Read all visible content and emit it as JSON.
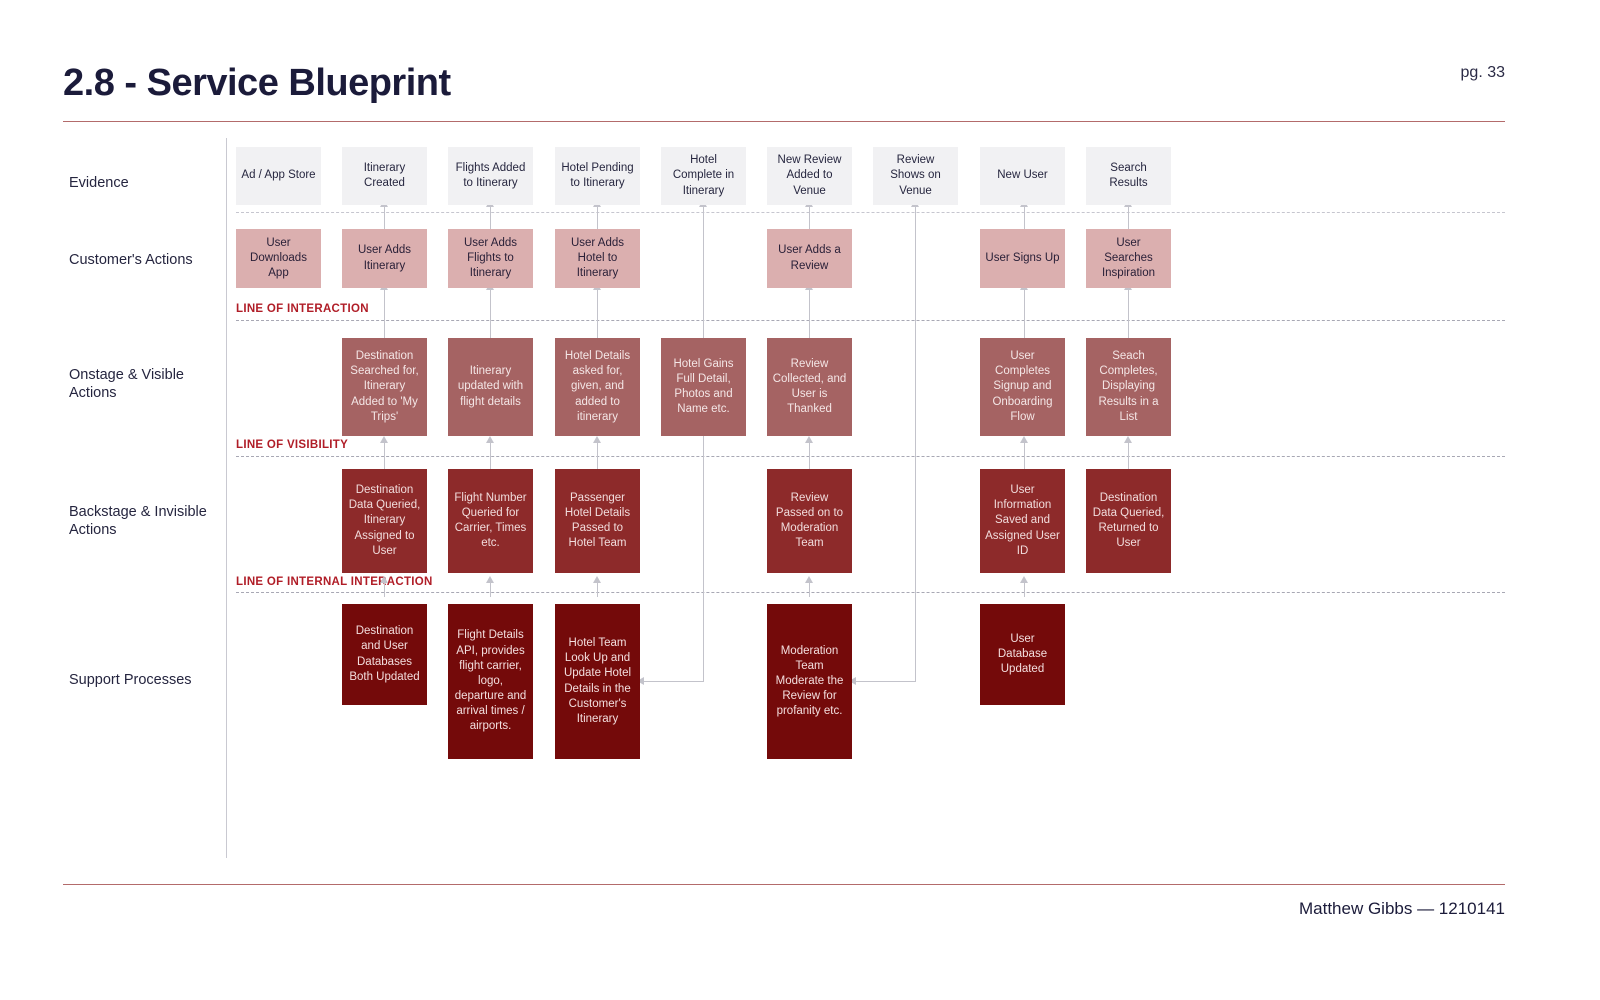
{
  "header": {
    "title": "2.8 - Service Blueprint",
    "page_number": "pg. 33"
  },
  "footer": {
    "credit": "Matthew Gibbs — 1210141"
  },
  "colors": {
    "accent_rule": "#b36b6b",
    "line_label": "#b01d27",
    "evidence": "#f1f1f3",
    "customer_actions": "#dbafaf",
    "onstage": "#a56363",
    "backstage": "#8d2a2a",
    "support": "#740a0a",
    "connector": "#c3c3cb",
    "title": "#1b1b3a"
  },
  "rows": [
    {
      "key": "evidence",
      "label": "Evidence"
    },
    {
      "key": "customer",
      "label": "Customer's Actions"
    },
    {
      "key": "onstage",
      "label": "Onstage & Visible Actions"
    },
    {
      "key": "backstage",
      "label": "Backstage & Invisible Actions"
    },
    {
      "key": "support",
      "label": "Support Processes"
    }
  ],
  "separators": [
    {
      "key": "interaction",
      "label": "LINE OF INTERACTION"
    },
    {
      "key": "visibility",
      "label": "LINE OF VISIBILITY"
    },
    {
      "key": "internal_interaction",
      "label": "LINE OF INTERNAL INTERACTION"
    }
  ],
  "evidence": [
    "Ad / App Store",
    "Itinerary Created",
    "Flights Added to Itinerary",
    "Hotel Pending to Itinerary",
    "Hotel Complete in Itinerary",
    "New Review Added to Venue",
    "Review Shows on Venue",
    "New User",
    "Search Results"
  ],
  "customer_actions": [
    "User Downloads App",
    "User Adds Itinerary",
    "User Adds Flights to Itinerary",
    "User Adds Hotel to Itinerary",
    "User Adds a Review",
    "User Signs Up",
    "User Searches Inspiration"
  ],
  "onstage_actions": [
    "Destination Searched for, Itinerary Added to 'My Trips'",
    "Itinerary updated with flight details",
    "Hotel Details asked for, given, and added to itinerary",
    "Hotel Gains Full Detail, Photos and Name etc.",
    "Review Collected, and User is Thanked",
    "User Completes Signup and Onboarding Flow",
    "Seach Completes, Displaying Results in a List"
  ],
  "backstage_actions": [
    "Destination Data Queried, Itinerary Assigned to User",
    "Flight Number Queried for Carrier, Times etc.",
    "Passenger Hotel Details Passed to Hotel Team",
    "Review Passed on to Moderation Team",
    "User Information Saved and Assigned User ID",
    "Destination Data Queried, Returned to User"
  ],
  "support_processes": [
    "Destination and User Databases Both Updated",
    "Flight Details API, provides flight carrier, logo, departure and arrival times / airports.",
    "Hotel Team Look Up and Update Hotel Details in the Customer's Itinerary",
    "Moderation Team Moderate the Review for profanity etc.",
    "User Database Updated"
  ]
}
